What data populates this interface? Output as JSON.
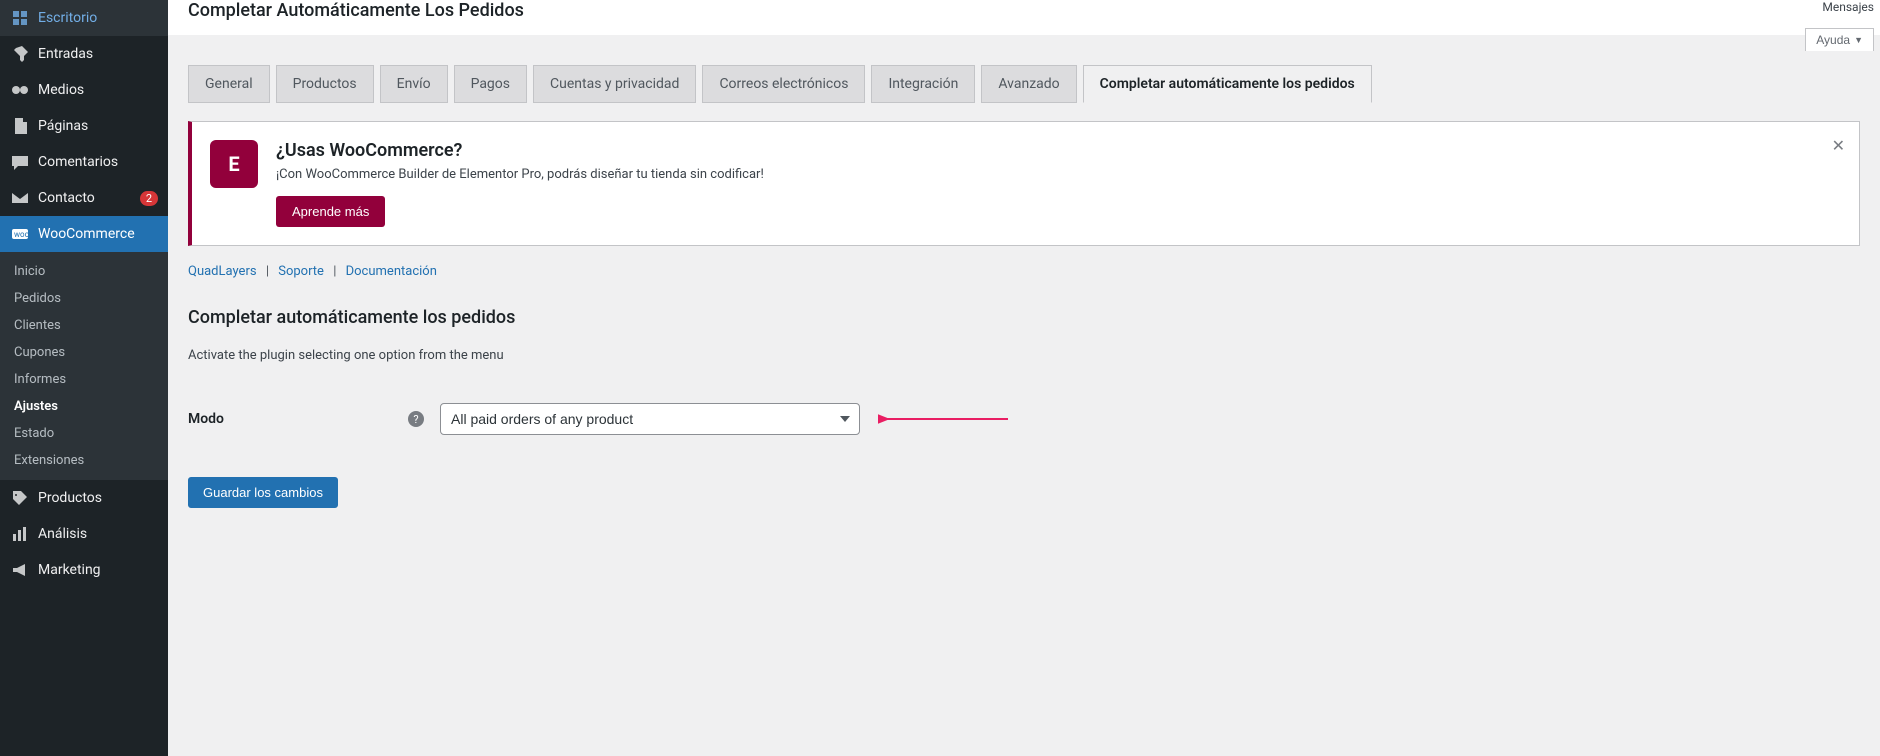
{
  "sidebar": {
    "items": [
      {
        "label": "Escritorio",
        "icon": "dashboard"
      },
      {
        "label": "Entradas",
        "icon": "pin"
      },
      {
        "label": "Medios",
        "icon": "media"
      },
      {
        "label": "Páginas",
        "icon": "pages"
      },
      {
        "label": "Comentarios",
        "icon": "comment"
      },
      {
        "label": "Contacto",
        "icon": "mail",
        "badge": "2"
      },
      {
        "label": "WooCommerce",
        "icon": "woo",
        "active": true
      },
      {
        "label": "Productos",
        "icon": "product"
      },
      {
        "label": "Análisis",
        "icon": "analytics"
      },
      {
        "label": "Marketing",
        "icon": "megaphone"
      }
    ],
    "submenu": [
      {
        "label": "Inicio"
      },
      {
        "label": "Pedidos"
      },
      {
        "label": "Clientes"
      },
      {
        "label": "Cupones"
      },
      {
        "label": "Informes"
      },
      {
        "label": "Ajustes",
        "current": true
      },
      {
        "label": "Estado"
      },
      {
        "label": "Extensiones"
      }
    ]
  },
  "page_title": "Completar Automáticamente Los Pedidos",
  "top_right": "Mensajes",
  "help_label": "Ayuda",
  "tabs": [
    {
      "label": "General"
    },
    {
      "label": "Productos"
    },
    {
      "label": "Envío"
    },
    {
      "label": "Pagos"
    },
    {
      "label": "Cuentas y privacidad"
    },
    {
      "label": "Correos electrónicos"
    },
    {
      "label": "Integración"
    },
    {
      "label": "Avanzado"
    },
    {
      "label": "Completar automáticamente los pedidos",
      "active": true
    }
  ],
  "notice": {
    "title": "¿Usas WooCommerce?",
    "body": "¡Con WooCommerce Builder de Elementor Pro, podrás diseñar tu tienda sin codificar!",
    "cta": "Aprende más",
    "logo_letter": "E"
  },
  "sublinks": {
    "quadlayers": "QuadLayers",
    "soporte": "Soporte",
    "documentacion": "Documentación"
  },
  "section": {
    "title": "Completar automáticamente los pedidos",
    "desc": "Activate the plugin selecting one option from the menu"
  },
  "form": {
    "modo_label": "Modo",
    "modo_value": "All paid orders of any product"
  },
  "save_button": "Guardar los cambios",
  "colors": {
    "accent": "#2271b1",
    "notice_accent": "#92003b",
    "annot_arrow": "#e91e63"
  }
}
